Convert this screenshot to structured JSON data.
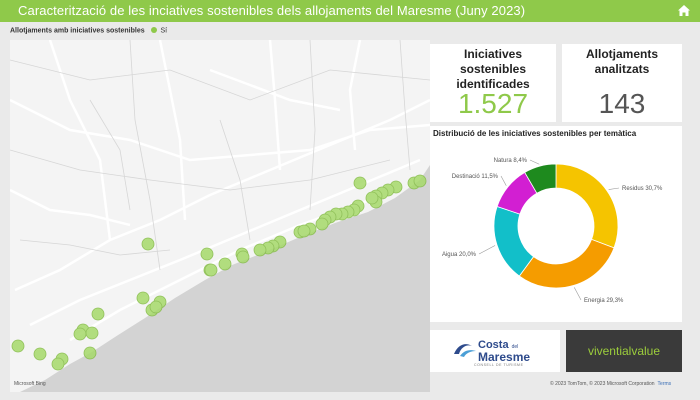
{
  "header": {
    "title": "Caracterització de les inciatives sostenibles dels allojaments del Maresme (Juny 2023)",
    "home_icon": "home-icon"
  },
  "map_legend": {
    "label": "Allotjaments amb iniciatives sostenibles",
    "item": "Sí",
    "item_color": "#8fc94a"
  },
  "kpis": [
    {
      "title": "Iniciatives sostenibles identificades",
      "value": "1.527"
    },
    {
      "title": "Allotjaments analitzats",
      "value": "143"
    }
  ],
  "chart_data": {
    "type": "pie",
    "title": "Distribució de les iniciatives sostenibles per temàtica",
    "donut": true,
    "categories": [
      "Residus",
      "Energia",
      "Aigua",
      "Destinació",
      "Natura"
    ],
    "values": [
      30.7,
      29.3,
      20.0,
      11.5,
      8.4
    ],
    "labels": [
      "Residus 30,7%",
      "Energia 29,3%",
      "Aigua 20,0%",
      "Destinació 11,5%",
      "Natura 8,4%"
    ],
    "colors": [
      "#f5c400",
      "#f59c00",
      "#12bfc9",
      "#d21fd2",
      "#1e8a1e"
    ]
  },
  "map_credits": {
    "provider": "Microsoft Bing",
    "copyright": "© 2023 TomTom, © 2023 Microsoft Corporation",
    "terms": "Terms"
  },
  "logos": {
    "costa": {
      "name_top": "Costa",
      "name_small": "del",
      "name_bottom": "Maresme",
      "tagline": "CONSELL DE TURISME"
    },
    "vivential": {
      "text": "viventialvalue"
    }
  }
}
